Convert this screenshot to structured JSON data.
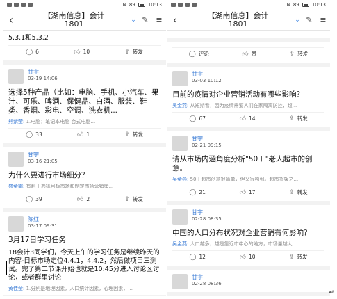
{
  "left": {
    "status": {
      "time": "10:13",
      "battery": "89",
      "signal_text": "N"
    },
    "header": {
      "title_line1": "【湖南信息】会计",
      "title_line2": "1801"
    },
    "top_post": {
      "text": "5.3.1和5.3.2",
      "comments": "6",
      "likes": "10",
      "share": "转发"
    },
    "posts": [
      {
        "name": "甘宇",
        "date": "03-19 14:06",
        "text": "选择5种产品（比如：电脑、手机、小汽车、果汁、可乐、啤酒、保健品、白酒、服装、鞋类、香烟、彩电、空调、洗衣机...",
        "reply_name": "熊紫莹:",
        "reply_text": "1.电脑：笔记本电脑 台式电脑...",
        "comments": "33",
        "likes": "1",
        "share": "转发"
      },
      {
        "name": "甘宇",
        "date": "03-16 21:05",
        "text": "为什么要进行市场细分？",
        "reply_name": "盛金霜:",
        "reply_text": "有利于选择目标市场和制定市场营销策...",
        "comments": "39",
        "likes": "2",
        "share": "转发"
      },
      {
        "name": "陈红",
        "date": "03-17 09:31",
        "text": "3月17日学习任务",
        "body": "18会计3同学们，今天上午的学习任务是继续昨天的内容-目标市场定位4.4.1，4.4.2，然后做项目三测试。完了第二节课开始也就是10:45分进入讨论区讨论，或者群里讨论",
        "reply_name": "黄佳莹:",
        "reply_text": "1.分别是地理因素，人口统计因素，心理因素，..."
      }
    ]
  },
  "right": {
    "status": {
      "time": "10:13",
      "battery": "89",
      "signal_text": "N"
    },
    "header": {
      "title_line1": "【湖南信息】会计",
      "title_line2": "1801"
    },
    "top_actions": {
      "comment": "评论",
      "like": "赞",
      "share": "转发"
    },
    "posts": [
      {
        "name": "甘宇",
        "date": "03-03 10:12",
        "text": "目前的疫情对企业营销活动有哪些影响？",
        "reply_name": "吴金燕:",
        "reply_text": "从短期看，因为疫情需要人们在家隔离防控，超...",
        "comments": "67",
        "likes": "14",
        "share": "转发"
      },
      {
        "name": "甘宇",
        "date": "02-21 09:15",
        "text": "请从市场内涵角度分析\"50＋\"老人超市的创意。",
        "reply_name": "吴金燕:",
        "reply_text": "50＋超市创意很简单，但又很独到。超市货架之...",
        "comments": "21",
        "likes": "17",
        "share": "转发"
      },
      {
        "name": "甘宇",
        "date": "02-28 08:35",
        "text": "中国的人口分布状况对企业营销有何影响？",
        "reply_name": "吴金燕:",
        "reply_text": "人口越多，越是靠近市中心的地方，市场量越大...",
        "comments": "12",
        "likes": "10",
        "share": "转发"
      },
      {
        "name": "甘宇",
        "date": "02-28 08:36"
      }
    ]
  },
  "icons": {
    "back": "back-arrow-icon",
    "edit": "edit-icon",
    "menu": "menu-icon"
  }
}
